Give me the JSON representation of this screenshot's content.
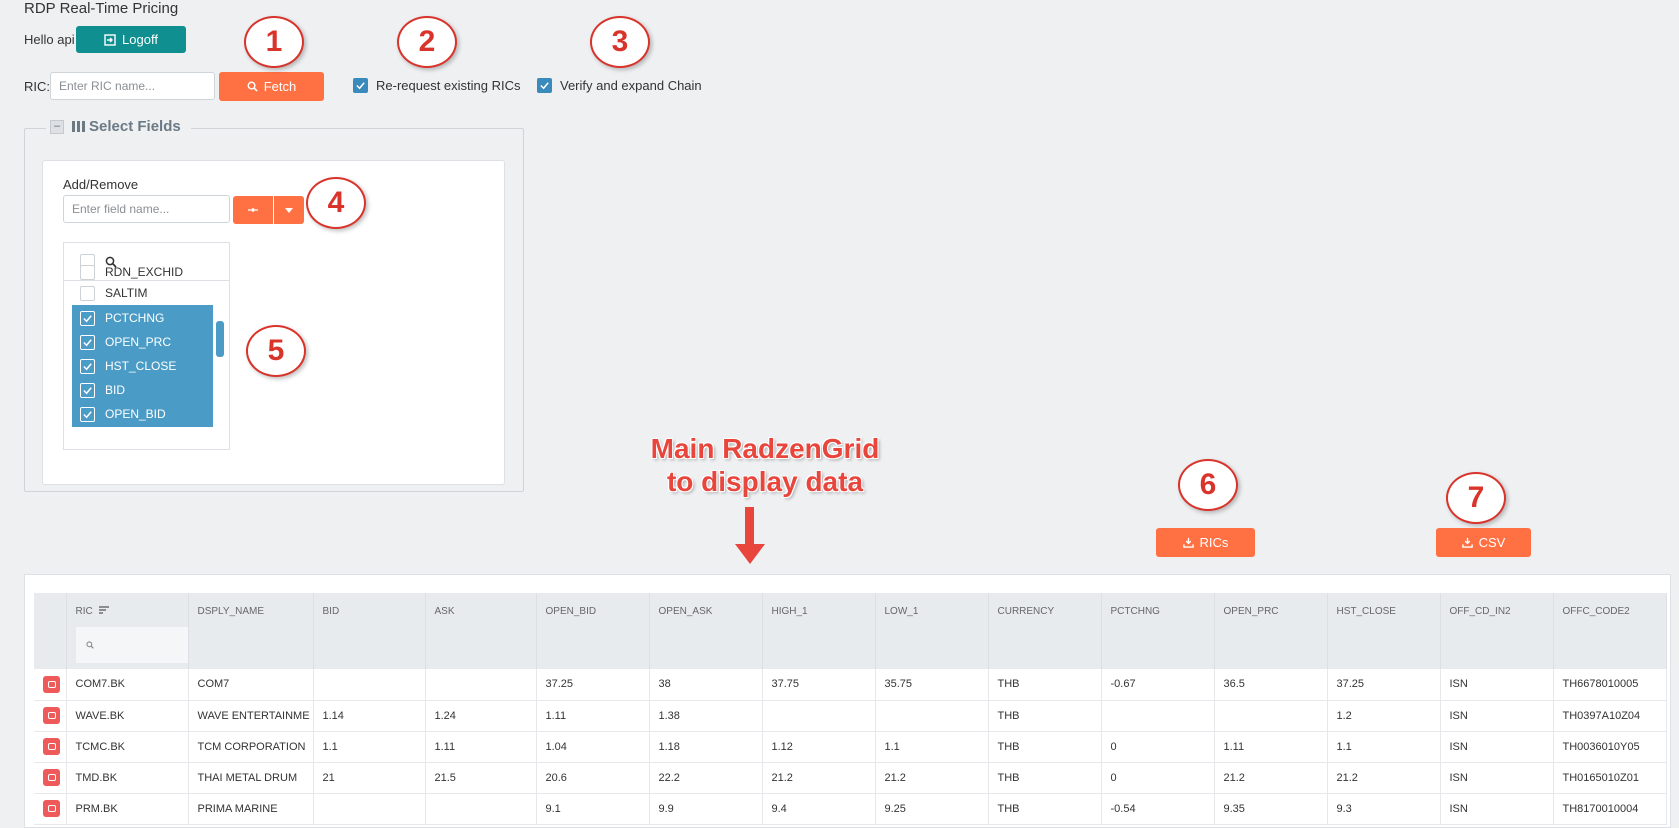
{
  "app": {
    "title": "RDP Real-Time Pricing",
    "greeting": "Hello api",
    "logoff_label": "Logoff"
  },
  "ric_form": {
    "label": "RIC:",
    "placeholder": "Enter RIC name...",
    "fetch_label": "Fetch",
    "rerequest": {
      "label": "Re-request existing RICs",
      "checked": true
    },
    "verify_chain": {
      "label": "Verify and expand Chain",
      "checked": true
    }
  },
  "fields_panel": {
    "legend": "Select Fields",
    "add_remove_label": "Add/Remove",
    "field_placeholder": "Enter field name...",
    "items": [
      {
        "label": "RDN_EXCHID",
        "checked": false
      },
      {
        "label": "SALTIM",
        "checked": false
      },
      {
        "label": "PCTCHNG",
        "checked": true
      },
      {
        "label": "OPEN_PRC",
        "checked": true
      },
      {
        "label": "HST_CLOSE",
        "checked": true
      },
      {
        "label": "BID",
        "checked": true
      },
      {
        "label": "OPEN_BID",
        "checked": true
      }
    ]
  },
  "annotations": {
    "callouts": [
      "1",
      "2",
      "3",
      "4",
      "5",
      "6",
      "7"
    ],
    "grid_label_line1": "Main RadzenGrid",
    "grid_label_line2": "to display data"
  },
  "export": {
    "rics_label": "RICs",
    "csv_label": "CSV"
  },
  "colors": {
    "accent_orange": "#ff7043",
    "teal": "#0f8f8f",
    "selection_blue": "#4a9bc6",
    "callout_red": "#d9342b"
  },
  "grid": {
    "columns": [
      "RIC",
      "DSPLY_NAME",
      "BID",
      "ASK",
      "OPEN_BID",
      "OPEN_ASK",
      "HIGH_1",
      "LOW_1",
      "CURRENCY",
      "PCTCHNG",
      "OPEN_PRC",
      "HST_CLOSE",
      "OFF_CD_IN2",
      "OFFC_CODE2"
    ],
    "rows": [
      [
        "COM7.BK",
        "COM7",
        "",
        "",
        "37.25",
        "38",
        "37.75",
        "35.75",
        "THB",
        "-0.67",
        "36.5",
        "37.25",
        "ISN",
        "TH6678010005"
      ],
      [
        "WAVE.BK",
        "WAVE ENTERTAINME",
        "1.14",
        "1.24",
        "1.11",
        "1.38",
        "",
        "",
        "THB",
        "",
        "",
        "1.2",
        "ISN",
        "TH0397A10Z04"
      ],
      [
        "TCMC.BK",
        "TCM CORPORATION",
        "1.1",
        "1.11",
        "1.04",
        "1.18",
        "1.12",
        "1.1",
        "THB",
        "0",
        "1.11",
        "1.1",
        "ISN",
        "TH0036010Y05"
      ],
      [
        "TMD.BK",
        "THAI METAL DRUM",
        "21",
        "21.5",
        "20.6",
        "22.2",
        "21.2",
        "21.2",
        "THB",
        "0",
        "21.2",
        "21.2",
        "ISN",
        "TH0165010Z01"
      ],
      [
        "PRM.BK",
        "PRIMA MARINE",
        "",
        "",
        "9.1",
        "9.9",
        "9.4",
        "9.25",
        "THB",
        "-0.54",
        "9.35",
        "9.3",
        "ISN",
        "TH8170010004"
      ]
    ]
  }
}
